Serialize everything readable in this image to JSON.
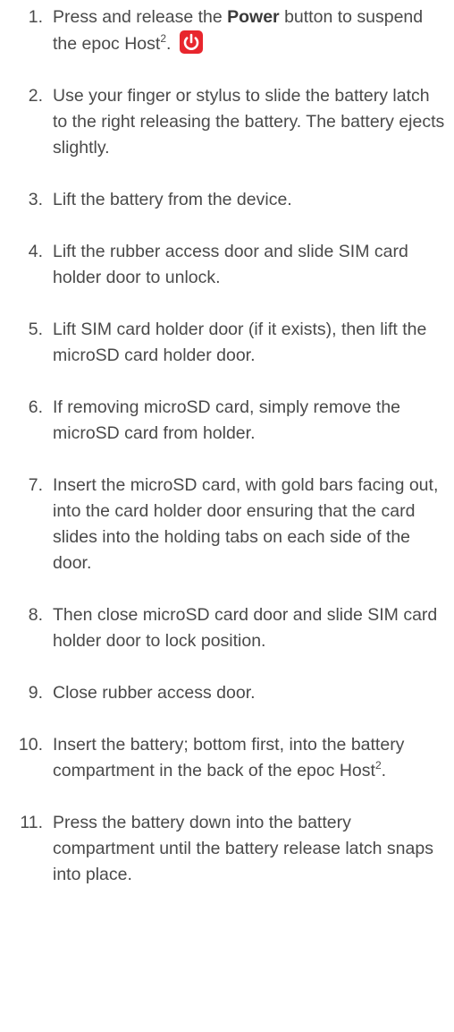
{
  "steps": [
    {
      "number": "1.",
      "pre": "Press and release the ",
      "bold": "Power",
      "mid": " button to suspend the epoc Host",
      "sup": "2",
      "post": ". ",
      "icon": "power-icon",
      "icon_color": "#e8262d"
    },
    {
      "number": "2.",
      "text": "Use your finger or stylus to slide the battery latch to the right releasing the battery. The battery ejects slightly."
    },
    {
      "number": "3.",
      "text": "Lift the battery from the device."
    },
    {
      "number": "4.",
      "text": "Lift the rubber access door and slide SIM card holder door to unlock."
    },
    {
      "number": "5.",
      "text": "Lift SIM card holder door (if it exists), then lift the microSD card holder door."
    },
    {
      "number": "6.",
      "text": "If removing microSD card, simply remove the microSD card from holder."
    },
    {
      "number": "7.",
      "text": "Insert the microSD card, with gold bars facing out, into the card holder door ensuring that the card slides into the holding tabs on each side of the door."
    },
    {
      "number": "8.",
      "text": "Then close microSD card door and slide SIM card holder door to lock position."
    },
    {
      "number": "9.",
      "text": "Close rubber access door."
    },
    {
      "number": "10.",
      "pre": "Insert the battery; bottom first, into the battery compartment in the back of the epoc Host",
      "sup": "2",
      "post": "."
    },
    {
      "number": "11.",
      "text": "Press the battery down into the battery compartment until the battery release latch snaps into place."
    }
  ]
}
